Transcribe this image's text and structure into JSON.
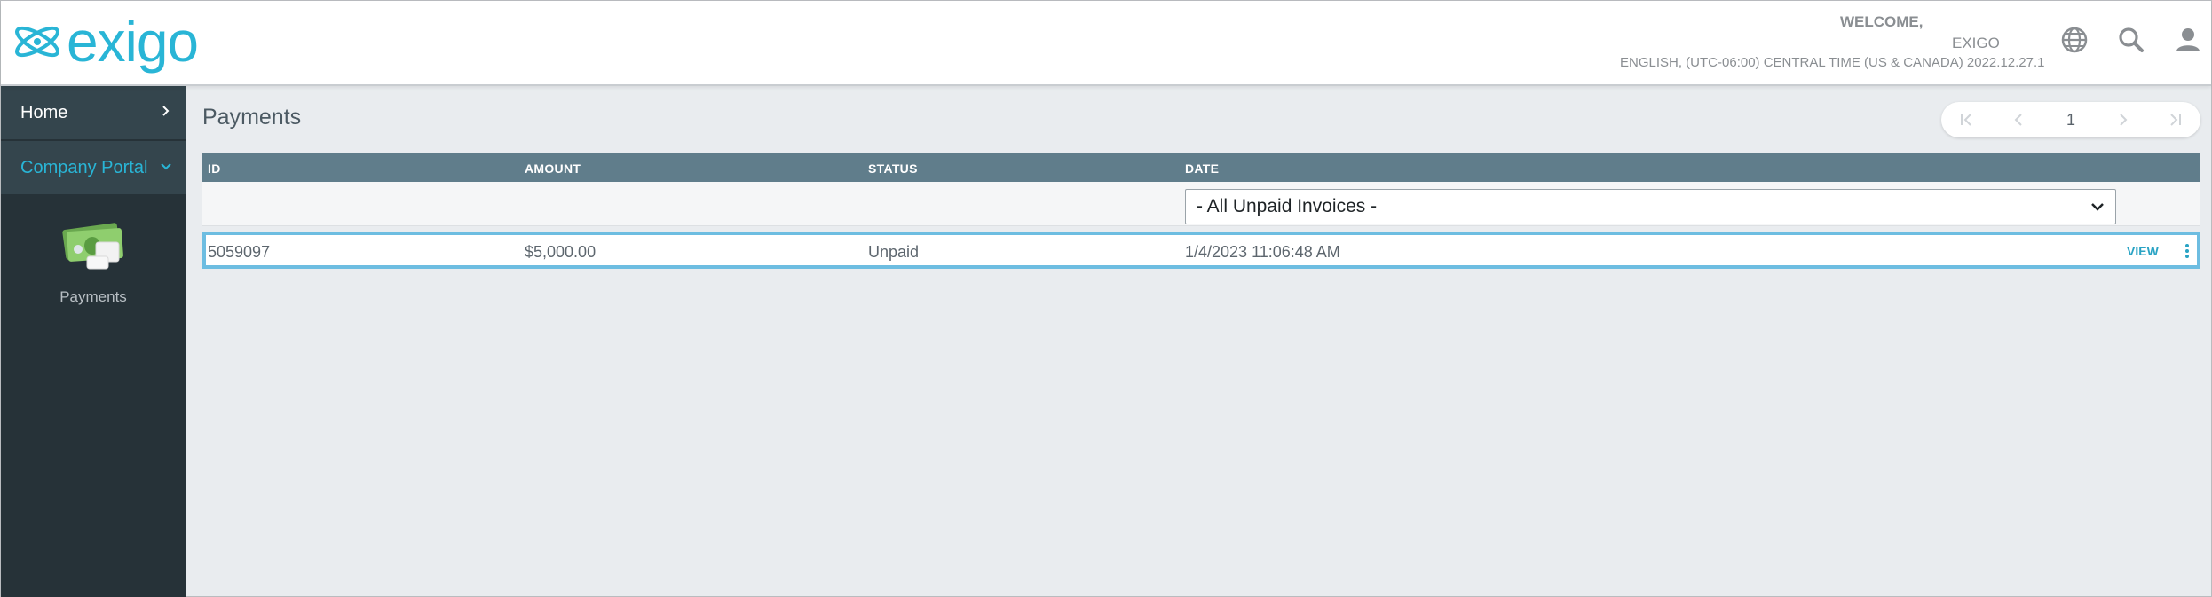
{
  "header": {
    "brand_name": "exigo",
    "welcome_label": "WELCOME,",
    "username": "EXIGO",
    "locale_info": "ENGLISH, (UTC-06:00) CENTRAL TIME (US & CANADA) 2022.12.27.1",
    "icons": [
      "globe-icon",
      "search-icon",
      "user-icon"
    ]
  },
  "sidebar": {
    "items": [
      {
        "label": "Home",
        "icon": "chevron-right-icon"
      },
      {
        "label": "Company Portal",
        "icon": "chevron-down-icon",
        "active": true
      }
    ],
    "tiles": [
      {
        "label": "Payments",
        "icon": "money-icon"
      }
    ]
  },
  "main": {
    "title": "Payments",
    "pager": {
      "current_page": "1",
      "buttons": [
        "first-page-icon",
        "prev-page-icon",
        "next-page-icon",
        "last-page-icon"
      ]
    },
    "table": {
      "columns": [
        "ID",
        "AMOUNT",
        "STATUS",
        "DATE"
      ],
      "date_filter_selected": "- All Unpaid Invoices -",
      "rows": [
        {
          "id": "5059097",
          "amount": "$5,000.00",
          "status": "Unpaid",
          "date": "1/4/2023 11:06:48 AM",
          "action": "VIEW"
        }
      ]
    }
  },
  "colors": {
    "accent": "#29b5d6",
    "sidebar_bg": "#263238",
    "table_header_bg": "#607d8b",
    "selected_row_border": "#6dbde1",
    "content_bg": "#e9ecef"
  }
}
